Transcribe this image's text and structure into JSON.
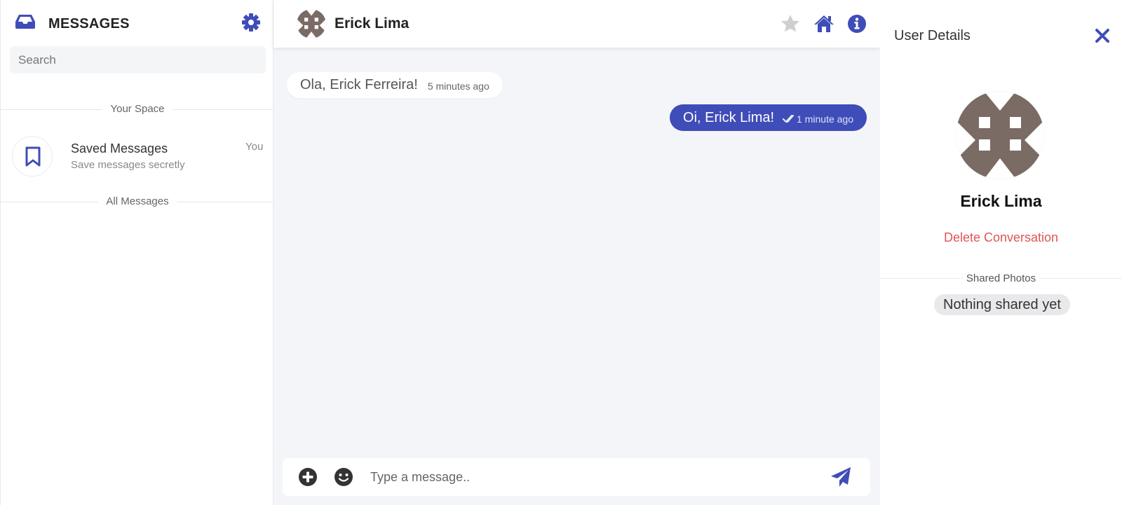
{
  "colors": {
    "accent": "#3f4db8",
    "danger": "#e05555",
    "chat_bg": "#f4f5f8",
    "avatar": "#7a6b65",
    "star": "#cfcfcf"
  },
  "sidebar": {
    "title": "MESSAGES",
    "search_placeholder": "Search",
    "section_your_space": "Your Space",
    "saved": {
      "name": "Saved Messages",
      "subtitle": "Save messages secretly",
      "owner": "You"
    },
    "section_all": "All Messages"
  },
  "chat": {
    "contact_name": "Erick Lima",
    "messages": [
      {
        "direction": "incoming",
        "text": "Ola, Erick Ferreira!",
        "time": "5 minutes ago"
      },
      {
        "direction": "outgoing",
        "text": "Oi, Erick Lima!",
        "time": "1 minute ago",
        "status": "read"
      }
    ],
    "composer_placeholder": "Type a message.."
  },
  "details": {
    "title": "User Details",
    "name": "Erick Lima",
    "delete_label": "Delete Conversation",
    "shared_photos_label": "Shared Photos",
    "shared_empty": "Nothing shared yet"
  },
  "icons": [
    "inbox-icon",
    "gear-icon",
    "bookmark-icon",
    "star-icon",
    "home-icon",
    "info-icon",
    "double-check-icon",
    "plus-circle-icon",
    "smiley-icon",
    "send-icon",
    "close-icon"
  ]
}
